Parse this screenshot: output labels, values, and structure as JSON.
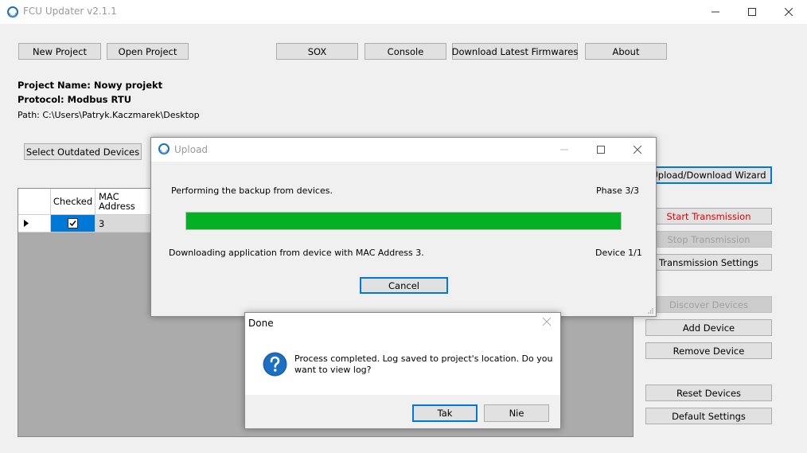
{
  "window": {
    "title": "FCU Updater v2.1.1"
  },
  "toolbar": {
    "new_project": "New Project",
    "open_project": "Open Project",
    "sox": "SOX",
    "console": "Console",
    "download_firmwares": "Download Latest Firmwares",
    "about": "About"
  },
  "project": {
    "name_label": "Project Name: Nowy projekt",
    "protocol_label": "Protocol: Modbus RTU",
    "path_label": "Path: C:\\Users\\Patryk.Kaczmarek\\Desktop"
  },
  "select_outdated": "Select Outdated Devices",
  "grid": {
    "columns": [
      "Checked",
      "MAC\nAddress"
    ],
    "rows": [
      {
        "checked": true,
        "mac": "3"
      }
    ]
  },
  "side_buttons": {
    "wizard": "Upload/Download Wizard",
    "start_transmission": "Start Transmission",
    "stop_transmission": "Stop Transmission",
    "transmission_settings": "Transmission Settings",
    "discover_devices": "Discover Devices",
    "add_device": "Add Device",
    "remove_device": "Remove Device",
    "reset_devices": "Reset Devices",
    "default_settings": "Default Settings"
  },
  "upload_dialog": {
    "title": "Upload",
    "status": "Performing the backup from devices.",
    "phase": "Phase 3/3",
    "progress": 1.0,
    "detail": "Downloading application from device with MAC Address 3.",
    "device_count": "Device 1/1",
    "cancel": "Cancel"
  },
  "done_dialog": {
    "title": "Done",
    "message_line1": "Process completed. Log saved to project's location. Do you",
    "message_line2": "want to view log?",
    "yes": "Tak",
    "no": "Nie"
  },
  "colors": {
    "accent": "#0078d7",
    "progress": "#06b025",
    "danger": "#e00000"
  }
}
